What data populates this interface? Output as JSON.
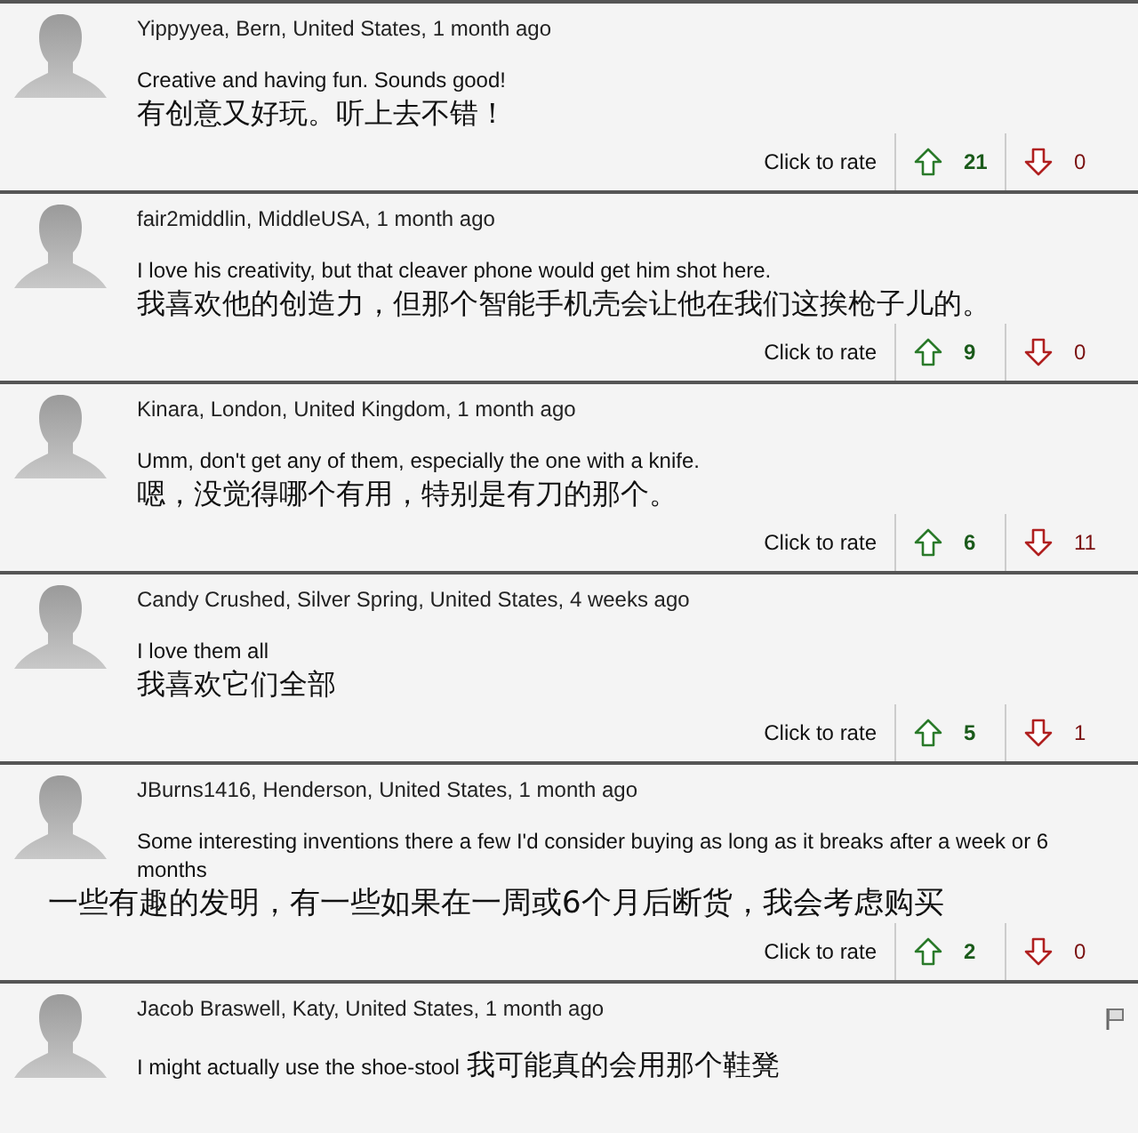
{
  "comments": [
    {
      "author": "Yippyyea, Bern, United States, 1 month ago",
      "text": "Creative and having fun. Sounds good!",
      "translation": "有创意又好玩。听上去不错！",
      "kind": "stacked",
      "show_flag": false,
      "rating": {
        "label": "Click to rate",
        "up": "21",
        "down": "0"
      }
    },
    {
      "author": "fair2middlin, MiddleUSA, 1 month ago",
      "text": "I love his creativity, but that cleaver phone would get him shot here.",
      "translation": "我喜欢他的创造力，但那个智能手机壳会让他在我们这挨枪子儿的。",
      "kind": "stacked",
      "show_flag": false,
      "rating": {
        "label": "Click to rate",
        "up": "9",
        "down": "0"
      }
    },
    {
      "author": "Kinara, London, United Kingdom, 1 month ago",
      "text": "Umm, don't get any of them, especially the one with a knife.",
      "translation": "嗯，没觉得哪个有用，特别是有刀的那个。",
      "kind": "stacked",
      "show_flag": false,
      "rating": {
        "label": "Click to rate",
        "up": "6",
        "down": "11"
      }
    },
    {
      "author": "Candy Crushed, Silver Spring, United States, 4 weeks ago",
      "text": "I love them all",
      "translation": "我喜欢它们全部",
      "kind": "stacked",
      "show_flag": false,
      "rating": {
        "label": "Click to rate",
        "up": "5",
        "down": "1"
      }
    },
    {
      "author": "JBurns1416, Henderson, United States, 1 month ago",
      "text": "Some interesting inventions there a few I'd consider buying as long as it breaks after a week or 6 months",
      "translation": "一些有趣的发明，有一些如果在一周或6个月后断货，我会考虑购买",
      "kind": "wide",
      "show_flag": false,
      "rating": {
        "label": "Click to rate",
        "up": "2",
        "down": "0"
      }
    },
    {
      "author": "Jacob Braswell, Katy, United States, 1 month ago",
      "text": "I might actually use the shoe-stool",
      "translation": "我可能真的会用那个鞋凳",
      "kind": "inline",
      "show_flag": true
    }
  ]
}
